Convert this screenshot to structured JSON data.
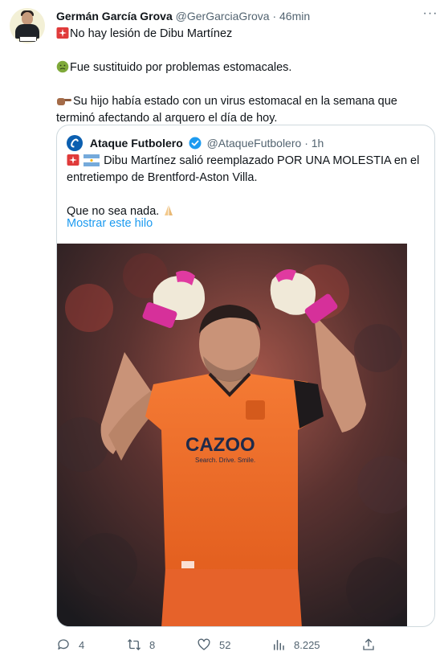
{
  "tweet": {
    "author_name": "Germán García Grova",
    "handle": "@GerGarciaGrova",
    "separator": "·",
    "time": "46min",
    "more_label": "···",
    "lines": [
      "No hay lesión de Dibu Martínez",
      "Fue sustituido por problemas estomacales.",
      "Su hijo había estado con un virus estomacal en la semana que terminó afectando al arquero el día de hoy."
    ]
  },
  "quote": {
    "author_name": "Ataque Futbolero",
    "handle": "@AtaqueFutbolero",
    "separator": "·",
    "time": "1h",
    "line1": "Dibu Martínez salió reemplazado POR UNA MOLESTIA en el entretiempo de Brentford-Aston Villa.",
    "line2": "Que no sea nada.",
    "show_thread": "Mostrar este hilo",
    "image_shirt_text": "CAZOO",
    "image_shirt_subtext": "Search. Drive. Smile."
  },
  "actions": {
    "replies": "4",
    "retweets": "8",
    "likes": "52",
    "views": "8.225"
  },
  "colors": {
    "link": "#1d9bf0",
    "secondary_text": "#536471",
    "border": "#cfd9de",
    "jersey": "#ef6a28"
  }
}
